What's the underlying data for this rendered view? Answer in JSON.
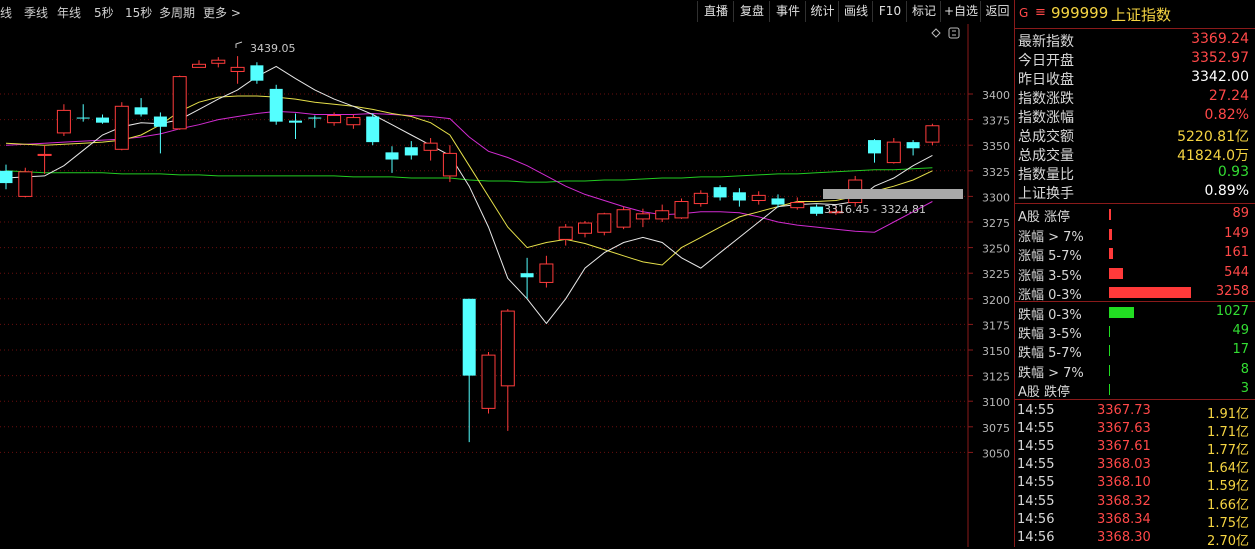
{
  "toolbar": {
    "periods": [
      "线",
      "季线",
      "年线",
      "5秒",
      "15秒",
      "多周期",
      "更多 >"
    ],
    "buttons": [
      "直播",
      "复盘",
      "事件",
      "统计",
      "画线",
      "F10",
      "标记",
      "+自选",
      "返回"
    ]
  },
  "chart": {
    "high_label": "3439.05",
    "ma_label": "3316.45 - 3324.81",
    "y_ticks": [
      "3400",
      "3375",
      "3350",
      "3325",
      "3300",
      "3275",
      "3250",
      "3225",
      "3200",
      "3175",
      "3150",
      "3125",
      "3100",
      "3075",
      "3050"
    ],
    "candles": [
      {
        "o": 3325,
        "c": 3313,
        "h": 3331,
        "l": 3307
      },
      {
        "o": 3300,
        "c": 3324,
        "h": 3328,
        "l": 3299
      },
      {
        "o": 3340,
        "c": 3341,
        "h": 3350,
        "l": 3322
      },
      {
        "o": 3362,
        "c": 3384,
        "h": 3390,
        "l": 3359
      },
      {
        "o": 3377,
        "c": 3376,
        "h": 3390,
        "l": 3373
      },
      {
        "o": 3377,
        "c": 3372,
        "h": 3380,
        "l": 3371
      },
      {
        "o": 3346,
        "c": 3388,
        "h": 3392,
        "l": 3345
      },
      {
        "o": 3387,
        "c": 3380,
        "h": 3396,
        "l": 3378
      },
      {
        "o": 3378,
        "c": 3368,
        "h": 3382,
        "l": 3342
      },
      {
        "o": 3366,
        "c": 3417,
        "h": 3418,
        "l": 3365
      },
      {
        "o": 3426,
        "c": 3429,
        "h": 3433,
        "l": 3426
      },
      {
        "o": 3430,
        "c": 3433,
        "h": 3436,
        "l": 3426
      },
      {
        "o": 3422,
        "c": 3426,
        "h": 3437,
        "l": 3410
      },
      {
        "o": 3428,
        "c": 3413,
        "h": 3431,
        "l": 3410
      },
      {
        "o": 3405,
        "c": 3373,
        "h": 3409,
        "l": 3370
      },
      {
        "o": 3374,
        "c": 3372,
        "h": 3381,
        "l": 3356
      },
      {
        "o": 3377,
        "c": 3376,
        "h": 3379,
        "l": 3367
      },
      {
        "o": 3372,
        "c": 3379,
        "h": 3382,
        "l": 3369
      },
      {
        "o": 3370,
        "c": 3377,
        "h": 3380,
        "l": 3366
      },
      {
        "o": 3378,
        "c": 3353,
        "h": 3381,
        "l": 3350
      },
      {
        "o": 3343,
        "c": 3336,
        "h": 3349,
        "l": 3323
      },
      {
        "o": 3348,
        "c": 3340,
        "h": 3354,
        "l": 3336
      },
      {
        "o": 3345,
        "c": 3352,
        "h": 3357,
        "l": 3335
      },
      {
        "o": 3320,
        "c": 3342,
        "h": 3350,
        "l": 3314
      },
      {
        "o": 3200,
        "c": 3125,
        "h": 3200,
        "l": 3060
      },
      {
        "o": 3093,
        "c": 3145,
        "h": 3148,
        "l": 3088
      },
      {
        "o": 3115,
        "c": 3188,
        "h": 3190,
        "l": 3071
      },
      {
        "o": 3225,
        "c": 3221,
        "h": 3240,
        "l": 3200
      },
      {
        "o": 3216,
        "c": 3234,
        "h": 3242,
        "l": 3211
      },
      {
        "o": 3258,
        "c": 3270,
        "h": 3273,
        "l": 3252
      },
      {
        "o": 3264,
        "c": 3274,
        "h": 3276,
        "l": 3260
      },
      {
        "o": 3265,
        "c": 3283,
        "h": 3284,
        "l": 3262
      },
      {
        "o": 3270,
        "c": 3287,
        "h": 3290,
        "l": 3268
      },
      {
        "o": 3278,
        "c": 3283,
        "h": 3288,
        "l": 3270
      },
      {
        "o": 3278,
        "c": 3286,
        "h": 3292,
        "l": 3275
      },
      {
        "o": 3279,
        "c": 3295,
        "h": 3298,
        "l": 3278
      },
      {
        "o": 3293,
        "c": 3303,
        "h": 3306,
        "l": 3290
      },
      {
        "o": 3309,
        "c": 3299,
        "h": 3311,
        "l": 3296
      },
      {
        "o": 3304,
        "c": 3296,
        "h": 3308,
        "l": 3290
      },
      {
        "o": 3296,
        "c": 3301,
        "h": 3305,
        "l": 3292
      },
      {
        "o": 3298,
        "c": 3292,
        "h": 3302,
        "l": 3289
      },
      {
        "o": 3289,
        "c": 3294,
        "h": 3299,
        "l": 3287
      },
      {
        "o": 3290,
        "c": 3283,
        "h": 3292,
        "l": 3281
      },
      {
        "o": 3285,
        "c": 3285,
        "h": 3291,
        "l": 3282
      },
      {
        "o": 3294,
        "c": 3316,
        "h": 3320,
        "l": 3290
      },
      {
        "o": 3355,
        "c": 3342,
        "h": 3356,
        "l": 3333
      },
      {
        "o": 3333,
        "c": 3353,
        "h": 3357,
        "l": 3332
      },
      {
        "o": 3353,
        "c": 3347,
        "h": 3355,
        "l": 3340
      },
      {
        "o": 3353,
        "c": 3369,
        "h": 3371,
        "l": 3350
      }
    ],
    "ma_white": [
      3318,
      3319,
      3320,
      3330,
      3345,
      3360,
      3368,
      3372,
      3371,
      3375,
      3385,
      3395,
      3404,
      3417,
      3427,
      3415,
      3404,
      3395,
      3388,
      3380,
      3370,
      3360,
      3350,
      3340,
      3310,
      3270,
      3220,
      3200,
      3176,
      3200,
      3230,
      3245,
      3255,
      3260,
      3255,
      3240,
      3230,
      3245,
      3260,
      3275,
      3290,
      3292,
      3293,
      3292,
      3295,
      3310,
      3318,
      3330,
      3340
    ],
    "ma_yellow": [
      3352,
      3351,
      3350,
      3351,
      3352,
      3353,
      3355,
      3360,
      3370,
      3383,
      3392,
      3397,
      3398,
      3398,
      3397,
      3395,
      3392,
      3390,
      3388,
      3385,
      3381,
      3378,
      3372,
      3360,
      3330,
      3300,
      3270,
      3250,
      3255,
      3258,
      3254,
      3248,
      3242,
      3236,
      3233,
      3250,
      3260,
      3270,
      3280,
      3285,
      3290,
      3295,
      3295,
      3296,
      3300,
      3305,
      3310,
      3316,
      3325
    ],
    "ma_magenta": [
      3350,
      3351,
      3352,
      3353,
      3354,
      3355,
      3356,
      3358,
      3361,
      3366,
      3370,
      3375,
      3378,
      3381,
      3383,
      3382,
      3380,
      3380,
      3380,
      3381,
      3380,
      3379,
      3378,
      3376,
      3358,
      3344,
      3338,
      3330,
      3320,
      3310,
      3302,
      3296,
      3290,
      3285,
      3282,
      3283,
      3285,
      3285,
      3284,
      3280,
      3275,
      3272,
      3270,
      3268,
      3266,
      3265,
      3275,
      3285,
      3295
    ],
    "ma_green": [
      3325,
      3324,
      3323,
      3323,
      3323,
      3323,
      3322,
      3322,
      3322,
      3321,
      3321,
      3320,
      3320,
      3320,
      3320,
      3320,
      3320,
      3320,
      3319,
      3319,
      3319,
      3318,
      3318,
      3318,
      3316,
      3315,
      3315,
      3314,
      3314,
      3315,
      3315,
      3316,
      3316,
      3317,
      3318,
      3318,
      3319,
      3319,
      3320,
      3321,
      3322,
      3322,
      3323,
      3324,
      3325,
      3326,
      3326,
      3327,
      3328
    ]
  },
  "panel": {
    "header": {
      "g": "G",
      "menu": "≡",
      "code": "999999",
      "name": "上证指数"
    },
    "quotes": [
      {
        "label": "最新指数",
        "value": "3369.24",
        "color": "#ff4848"
      },
      {
        "label": "今日开盘",
        "value": "3352.97",
        "color": "#ff4848"
      },
      {
        "label": "昨日收盘",
        "value": "3342.00",
        "color": "#ffffff"
      },
      {
        "label": "指数涨跌",
        "value": "27.24",
        "color": "#ff4848"
      },
      {
        "label": "指数涨幅",
        "value": "0.82%",
        "color": "#ff4848"
      },
      {
        "label": "总成交额",
        "value": "5220.81亿",
        "color": "#f5d442"
      },
      {
        "label": "总成交量",
        "value": "41824.0万",
        "color": "#f5d442"
      },
      {
        "label": "指数量比",
        "value": "0.93",
        "color": "#33dd33"
      },
      {
        "label": "上证换手",
        "value": "0.89%",
        "color": "#ffffff"
      }
    ],
    "up_stats": [
      {
        "label": "A股 涨停",
        "value": "89",
        "bar": 0.03
      },
      {
        "label": "涨幅 > 7%",
        "value": "149",
        "bar": 0.04
      },
      {
        "label": "涨幅 5-7%",
        "value": "161",
        "bar": 0.05
      },
      {
        "label": "涨幅 3-5%",
        "value": "544",
        "bar": 0.17
      },
      {
        "label": "涨幅 0-3%",
        "value": "3258",
        "bar": 1.0
      }
    ],
    "down_stats": [
      {
        "label": "跌幅 0-3%",
        "value": "1027",
        "bar": 0.31
      },
      {
        "label": "跌幅 3-5%",
        "value": "49",
        "bar": 0.015
      },
      {
        "label": "跌幅 5-7%",
        "value": "17",
        "bar": 0.01
      },
      {
        "label": "跌幅 > 7%",
        "value": "8",
        "bar": 0.01
      },
      {
        "label": "A股 跌停",
        "value": "3",
        "bar": 0.01
      }
    ],
    "ticks": [
      {
        "time": "14:55",
        "price": "3367.73",
        "amount": "1.91亿"
      },
      {
        "time": "14:55",
        "price": "3367.63",
        "amount": "1.71亿"
      },
      {
        "time": "14:55",
        "price": "3367.61",
        "amount": "1.77亿"
      },
      {
        "time": "14:55",
        "price": "3368.03",
        "amount": "1.64亿"
      },
      {
        "time": "14:55",
        "price": "3368.10",
        "amount": "1.59亿"
      },
      {
        "time": "14:55",
        "price": "3368.32",
        "amount": "1.66亿"
      },
      {
        "time": "14:56",
        "price": "3368.34",
        "amount": "1.75亿"
      },
      {
        "time": "14:56",
        "price": "3368.30",
        "amount": "2.70亿"
      }
    ]
  }
}
